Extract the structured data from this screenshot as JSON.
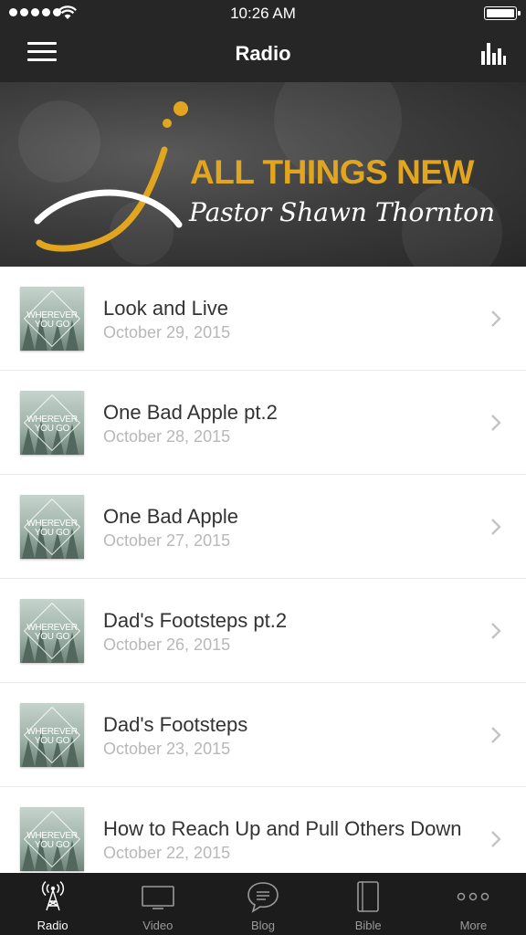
{
  "status_bar": {
    "time": "10:26 AM"
  },
  "nav": {
    "title": "Radio"
  },
  "banner": {
    "title": "ALL THINGS NEW",
    "subtitle": "Pastor Shawn Thornton"
  },
  "episodes": [
    {
      "title": "Look and Live",
      "date": "October 29, 2015",
      "thumb_text": [
        "WHEREVER",
        "YOU GO"
      ]
    },
    {
      "title": "One Bad Apple pt.2",
      "date": "October 28, 2015",
      "thumb_text": [
        "WHEREVER",
        "YOU GO"
      ]
    },
    {
      "title": "One Bad Apple",
      "date": "October 27, 2015",
      "thumb_text": [
        "WHEREVER",
        "YOU GO"
      ]
    },
    {
      "title": "Dad's Footsteps pt.2",
      "date": "October 26, 2015",
      "thumb_text": [
        "WHEREVER",
        "YOU GO"
      ]
    },
    {
      "title": "Dad's Footsteps",
      "date": "October 23, 2015",
      "thumb_text": [
        "WHEREVER",
        "YOU GO"
      ]
    },
    {
      "title": "How to Reach Up and Pull Others Down",
      "date": "October 22, 2015",
      "thumb_text": [
        "WHEREVER",
        "YOU GO"
      ]
    }
  ],
  "tabs": [
    {
      "label": "Radio",
      "icon": "radio-tower-icon",
      "active": true
    },
    {
      "label": "Video",
      "icon": "tv-icon",
      "active": false
    },
    {
      "label": "Blog",
      "icon": "chat-bubble-icon",
      "active": false
    },
    {
      "label": "Bible",
      "icon": "book-icon",
      "active": false
    },
    {
      "label": "More",
      "icon": "more-dots-icon",
      "active": false
    }
  ],
  "colors": {
    "brand_accent": "#E2A51F",
    "bar_background": "#262626",
    "tab_background": "#1C1C1C"
  }
}
